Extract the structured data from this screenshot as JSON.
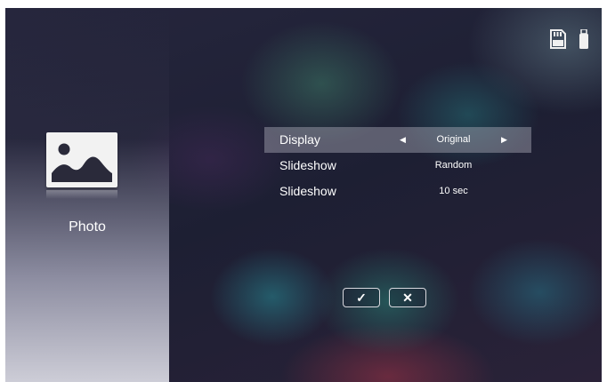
{
  "source": {
    "label": "Photo",
    "icon": "photo-icon"
  },
  "status_icons": [
    "sd-card-icon",
    "usb-drive-icon"
  ],
  "menu": {
    "rows": [
      {
        "label": "Display",
        "value": "Original",
        "selected": true
      },
      {
        "label": "Slideshow",
        "value": "Random",
        "selected": false
      },
      {
        "label": "Slideshow",
        "value": "10 sec",
        "selected": false
      }
    ]
  },
  "dialog": {
    "confirm_symbol": "✓",
    "cancel_symbol": "✕"
  }
}
